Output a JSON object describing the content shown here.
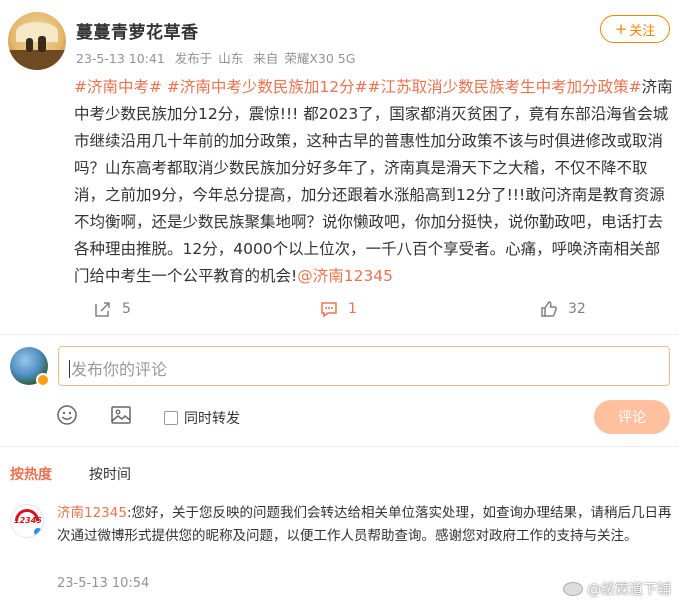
{
  "post": {
    "username": "蔓蔓青萝花草香",
    "time": "23-5-13 10:41",
    "published_at_label": "发布于",
    "location": "山东",
    "source_label": "来自",
    "device": "荣耀X30 5G",
    "follow_label": "关注",
    "hashtags": [
      "#济南中考#",
      "#济南中考少数民族加12分#",
      "#江苏取消少数民族考生中考加分政策#"
    ],
    "body_text": "济南中考少数民族加分12分，震惊!!! 都2023了，国家都消灭贫困了，竟有东部沿海省会城市继续沿用几十年前的加分政策，这种古早的普惠性加分政策不该与时俱进修改或取消吗？山东高考都取消少数民族加分好多年了，济南真是滑天下之大稽，不仅不降不取消，之前加9分，今年总分提高，加分还跟着水涨船高到12分了!!!敢问济南是教育资源不均衡啊，还是少数民族聚集地啊？说你懒政吧，你加分挺快，说你勤政吧，电话打去各种理由推脱。12分，4000个以上位次，一千八百个享受者。心痛，呼唤济南相关部门给中考生一个公平教育的机会!",
    "mention": "@济南12345"
  },
  "actions": {
    "forward_count": "5",
    "comment_count": "1",
    "like_count": "32"
  },
  "comment_box": {
    "placeholder": "发布你的评论",
    "also_forward_label": "同时转发",
    "submit_label": "评论"
  },
  "sort": {
    "by_hot": "按热度",
    "by_time": "按时间"
  },
  "reply": {
    "username": "济南12345",
    "text": ":您好，关于您反映的问题我们会转达给相关单位落实处理，如查询办理结果，请稍后几日再次通过微博形式提供您的昵称及问题，以便工作人员帮助查询。感谢您对政府工作的支持与关注。",
    "avatar_text": "12345",
    "time": "23-5-13 10:54"
  },
  "watermark": {
    "text": "@绥霖道下辅"
  },
  "colors": {
    "accent": "#eb7350",
    "follow": "#ff8200",
    "submit_disabled": "#ffc09f",
    "meta_gray": "#939393"
  }
}
